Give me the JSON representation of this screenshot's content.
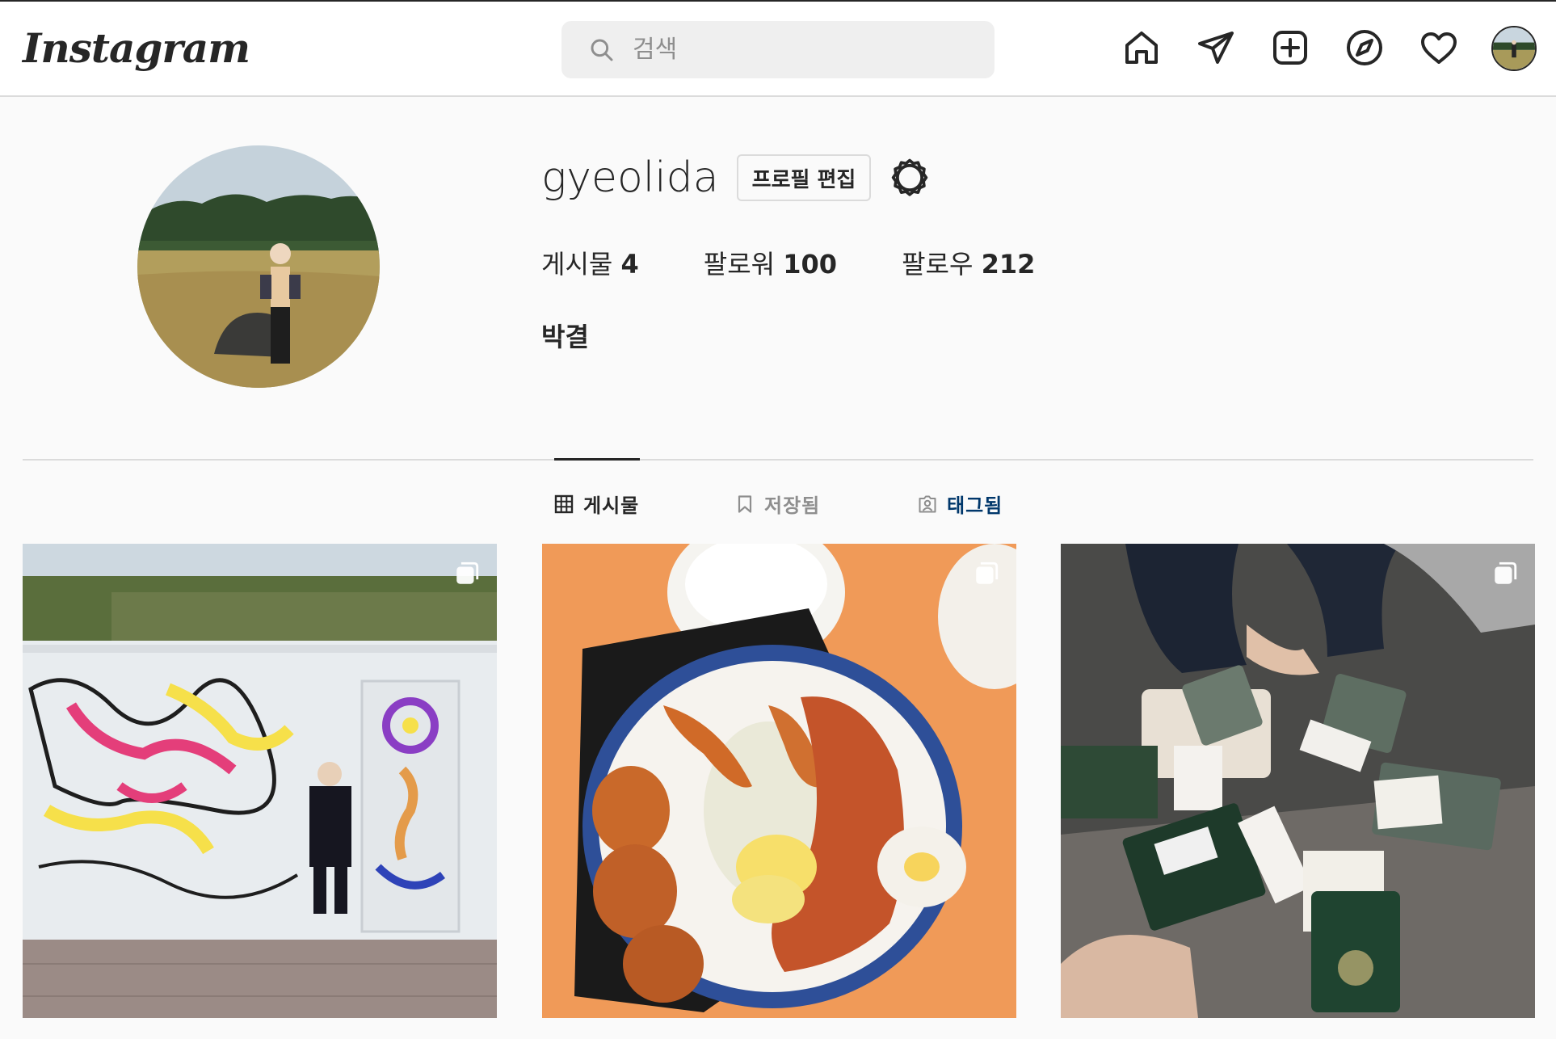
{
  "header": {
    "logo_text": "Instagram",
    "search_placeholder": "검색",
    "icons": [
      "home-icon",
      "direct-message-icon",
      "new-post-icon",
      "explore-icon",
      "activity-heart-icon"
    ]
  },
  "profile": {
    "username": "gyeolida",
    "edit_label": "프로필 편집",
    "stats": [
      {
        "label": "게시물",
        "value": "4"
      },
      {
        "label": "팔로워",
        "value": "100"
      },
      {
        "label": "팔로우",
        "value": "212"
      }
    ],
    "full_name": "박결"
  },
  "tabs": [
    {
      "label": "게시물",
      "icon": "grid-icon",
      "active": true
    },
    {
      "label": "저장됨",
      "icon": "bookmark-icon",
      "active": false
    },
    {
      "label": "태그됨",
      "icon": "tagged-user-icon",
      "active": false
    }
  ],
  "posts": [
    {
      "scene": "mural-wall",
      "multiple": true
    },
    {
      "scene": "food-tray",
      "multiple": true
    },
    {
      "scene": "passports",
      "multiple": true
    }
  ],
  "colors": {
    "text": "#262626",
    "muted": "#8e8e8e",
    "border": "#dbdbdb",
    "tagged": "#00376b",
    "background": "#fafafa"
  }
}
